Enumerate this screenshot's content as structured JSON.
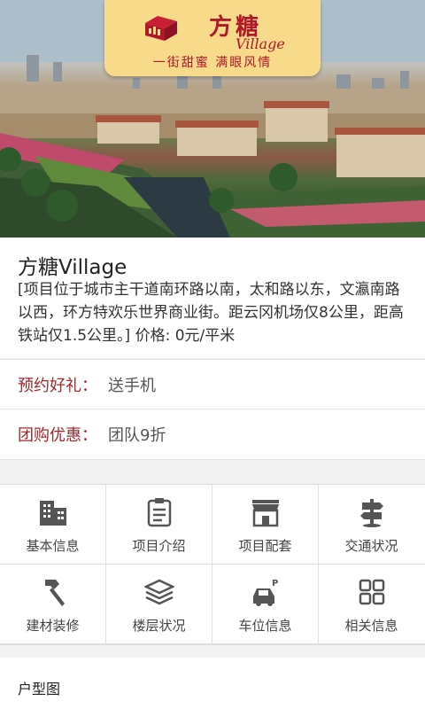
{
  "brand": {
    "name": "方糖",
    "sub": "Village",
    "tagline": "一街甜蜜 满眼风情"
  },
  "project": {
    "title": "方糖Village",
    "description": "[项目位于城市主干道南环路以南，太和路以东，文瀛南路以西，环方特欢乐世界商业街。距云冈机场仅8公里，距高铁站仅1.5公里。] 价格: 0元/平米"
  },
  "rows": [
    {
      "key": "预约好礼：",
      "value": "送手机"
    },
    {
      "key": "团购优惠：",
      "value": "团队9折"
    }
  ],
  "grid": [
    {
      "label": "基本信息",
      "icon": "building-icon"
    },
    {
      "label": "项目介绍",
      "icon": "clipboard-icon"
    },
    {
      "label": "项目配套",
      "icon": "storefront-icon"
    },
    {
      "label": "交通状况",
      "icon": "signpost-icon"
    },
    {
      "label": "建材装修",
      "icon": "hammer-icon"
    },
    {
      "label": "楼层状况",
      "icon": "layers-icon"
    },
    {
      "label": "车位信息",
      "icon": "parking-car-icon"
    },
    {
      "label": "相关信息",
      "icon": "grid-icon"
    }
  ],
  "section": {
    "title": "户型图"
  },
  "colors": {
    "accent": "#a5262d",
    "logo_bg": "#f7da8a",
    "logo_text": "#b1182a"
  }
}
